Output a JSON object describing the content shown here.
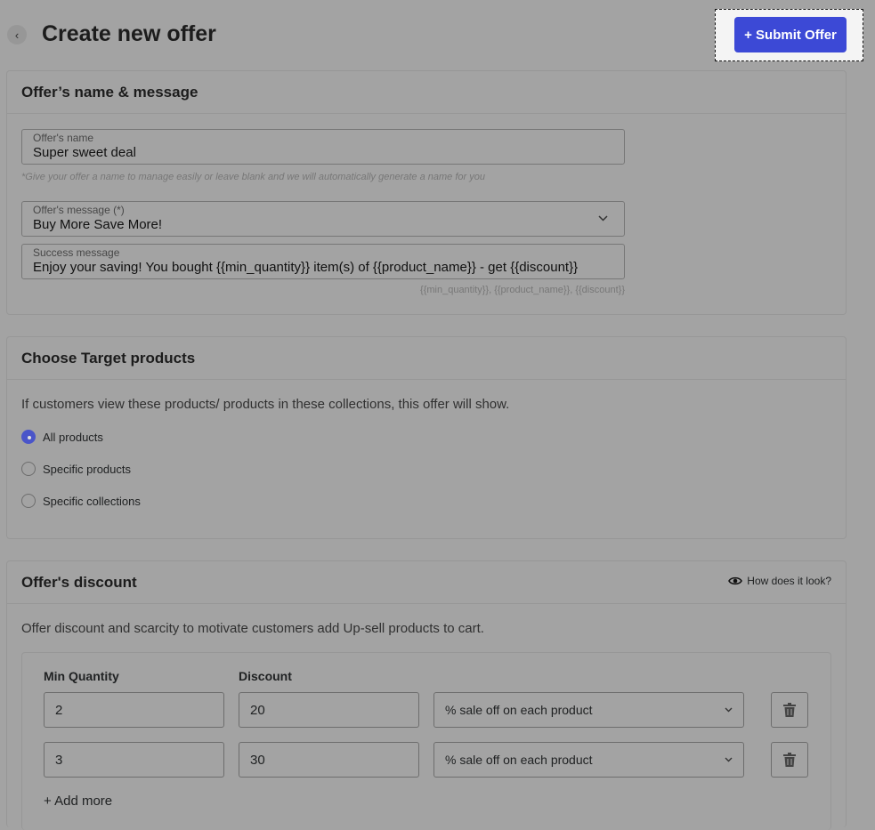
{
  "header": {
    "back_icon": "chevron-left-icon",
    "title": "Create new offer",
    "submit_label": "+ Submit Offer"
  },
  "offer_name_card": {
    "title": "Offer’s name & message",
    "name_field": {
      "label": "Offer's name",
      "value": "Super sweet deal"
    },
    "name_hint": "*Give your offer a name to manage easily or leave blank and we will automatically generate a name for you",
    "message_field": {
      "label": "Offer's message (*)",
      "value": "Buy More Save More!"
    },
    "success_field": {
      "label": "Success message",
      "value": "Enjoy your saving! You bought {{min_quantity}} item(s) of {{product_name}} - get {{discount}}"
    },
    "variables": "{{min_quantity}}, {{product_name}}, {{discount}}"
  },
  "target_card": {
    "title": "Choose Target products",
    "description": "If customers view these products/ products in these collections, this offer will show.",
    "options": [
      {
        "label": "All products",
        "checked": true
      },
      {
        "label": "Specific products",
        "checked": false
      },
      {
        "label": "Specific collections",
        "checked": false
      }
    ]
  },
  "discount_card": {
    "title": "Offer's discount",
    "how_link": "How does it look?",
    "description": "Offer discount and scarcity to motivate customers add Up-sell products to cart.",
    "col_min_quantity": "Min Quantity",
    "col_discount": "Discount",
    "rows": [
      {
        "min_quantity": "2",
        "discount": "20",
        "type": "% sale off on each product"
      },
      {
        "min_quantity": "3",
        "discount": "30",
        "type": "% sale off on each product"
      }
    ],
    "add_more": "+ Add more"
  },
  "colors": {
    "accent": "#3c49d6",
    "overlay_bg": "#a3a3a3"
  }
}
